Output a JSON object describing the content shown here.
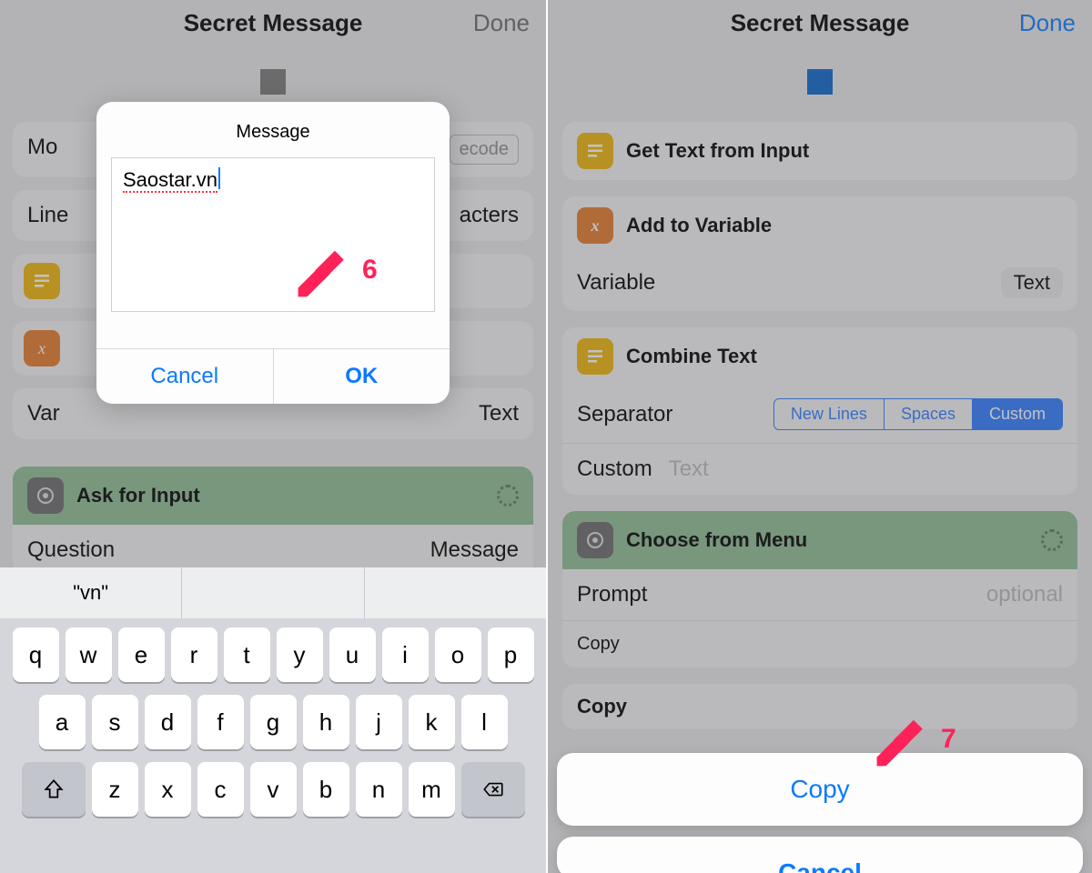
{
  "left": {
    "title": "Secret Message",
    "done": "Done",
    "modal": {
      "title": "Message",
      "input_value": "Saostar.vn",
      "cancel": "Cancel",
      "ok": "OK"
    },
    "bg": {
      "mode_label": "Mo",
      "decode_fragment": "ecode",
      "line_label": "Line",
      "line_value": "acters",
      "var_label": "Var",
      "var_value": "Text",
      "ask_title": "Ask for Input",
      "question_label": "Question",
      "question_value": "Message"
    },
    "suggestions": [
      "\"vn\"",
      "",
      ""
    ],
    "keys": {
      "r1": [
        "q",
        "w",
        "e",
        "r",
        "t",
        "y",
        "u",
        "i",
        "o",
        "p"
      ],
      "r2": [
        "a",
        "s",
        "d",
        "f",
        "g",
        "h",
        "j",
        "k",
        "l"
      ],
      "r3": [
        "z",
        "x",
        "c",
        "v",
        "b",
        "n",
        "m"
      ]
    },
    "annot_num": "6"
  },
  "right": {
    "title": "Secret Message",
    "done": "Done",
    "actions": {
      "a1": "Get Text from Input",
      "a2": "Add to Variable",
      "var_label": "Variable",
      "var_value": "Text",
      "a3": "Combine Text",
      "sep_label": "Separator",
      "seg": [
        "New Lines",
        "Spaces",
        "Custom"
      ],
      "custom_label": "Custom",
      "custom_placeholder": "Text",
      "a4": "Choose from Menu",
      "prompt_label": "Prompt",
      "prompt_value": "optional",
      "copy1": "Copy",
      "copy2": "Copy"
    },
    "sheet": {
      "copy": "Copy",
      "cancel": "Cancel"
    },
    "annot_num": "7"
  }
}
